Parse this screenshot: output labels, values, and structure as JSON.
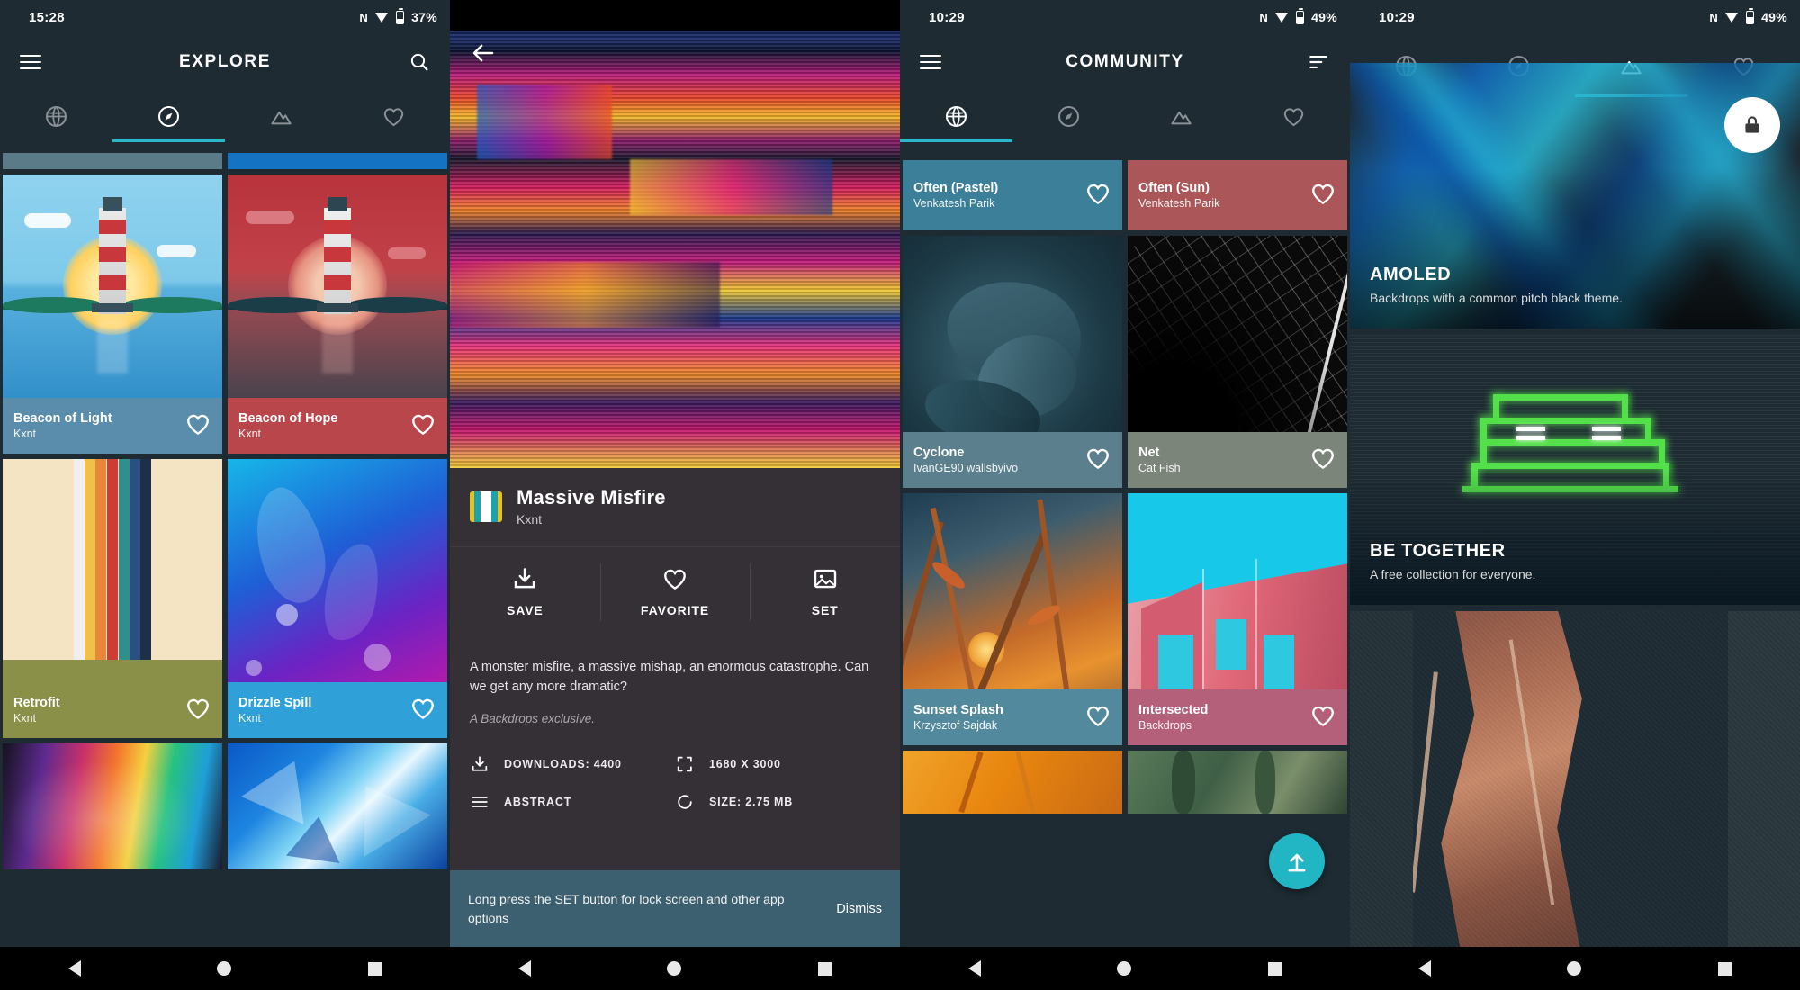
{
  "colors": {
    "app_bg": "#1e2b33",
    "accent": "#29b6c6",
    "detail_bg": "#343036",
    "snack_bg": "#3c6070",
    "fab": "#22b5c4"
  },
  "panel1": {
    "status": {
      "time": "15:28",
      "network_icon": "N",
      "wifi_icon": "wifi-icon",
      "battery_icon": "battery-icon",
      "battery": "37%"
    },
    "appbar": {
      "menu_icon": "hamburger-menu-icon",
      "title": "EXPLORE",
      "action_icon": "search-icon"
    },
    "tabs": [
      {
        "name": "globe-icon",
        "active": false
      },
      {
        "name": "compass-icon",
        "active": true
      },
      {
        "name": "landscape-icon",
        "active": false
      },
      {
        "name": "heart-icon",
        "active": false
      }
    ],
    "cards": [
      {
        "name": "Beacon of Light",
        "author": "Kxnt",
        "label_color": "#5a8dab",
        "art": "lighthouse-day"
      },
      {
        "name": "Beacon of Hope",
        "author": "Kxnt",
        "label_color": "#b8464a",
        "art": "lighthouse-dusk"
      },
      {
        "name": "Retrofit",
        "author": "Kxnt",
        "label_color": "#8a9047",
        "art": "retro-stripes"
      },
      {
        "name": "Drizzle Spill",
        "author": "Kxnt",
        "label_color": "#2fa0d8",
        "art": "drizzle"
      }
    ],
    "nav": {
      "back": "back-nav-icon",
      "home": "home-nav-icon",
      "recents": "recents-nav-icon"
    }
  },
  "panel2": {
    "appbar": {
      "back_icon": "back-arrow-icon"
    },
    "wallpaper": {
      "title": "Massive Misfire",
      "author": "Kxnt",
      "palette": [
        "#e8c21d",
        "#1aa3ae",
        "#ffffff",
        "#1aa3ae",
        "#e8c21d"
      ]
    },
    "actions": [
      {
        "icon": "download-icon",
        "label": "SAVE"
      },
      {
        "icon": "heart-icon",
        "label": "FAVORITE"
      },
      {
        "icon": "image-icon",
        "label": "SET"
      }
    ],
    "description": "A monster misfire, a massive mishap, an enormous catastrophe. Can we get any more dramatic?",
    "exclusive": "A Backdrops exclusive.",
    "meta": [
      {
        "icon": "download-icon",
        "text": "DOWNLOADS: 4400"
      },
      {
        "icon": "resolution-icon",
        "text": "1680 X 3000"
      },
      {
        "icon": "category-icon",
        "text": "ABSTRACT"
      },
      {
        "icon": "size-icon",
        "text": "SIZE: 2.75 MB"
      }
    ],
    "snackbar": {
      "message": "Long press the SET button for lock screen and other app options",
      "action": "Dismiss"
    },
    "nav": {
      "back": "back-nav-icon",
      "home": "home-nav-icon",
      "recents": "recents-nav-icon"
    }
  },
  "panel3": {
    "status": {
      "time": "10:29",
      "network_icon": "N",
      "wifi_icon": "wifi-icon",
      "battery_icon": "battery-icon",
      "battery": "49%"
    },
    "appbar": {
      "menu_icon": "hamburger-menu-icon",
      "title": "COMMUNITY",
      "action_icon": "sort-icon"
    },
    "tabs": [
      {
        "name": "globe-icon",
        "active": true
      },
      {
        "name": "compass-icon",
        "active": false
      },
      {
        "name": "landscape-icon",
        "active": false
      },
      {
        "name": "heart-icon",
        "active": false
      }
    ],
    "cards": [
      {
        "name": "Often (Pastel)",
        "author": "Venkatesh Parik",
        "label_color": "#3b7f99",
        "art": "pastel-glitch"
      },
      {
        "name": "Often (Sun)",
        "author": "Venkatesh Parik",
        "label_color": "#ab5659",
        "art": "sun-glitch"
      },
      {
        "name": "Cyclone",
        "author": "IvanGE90 wallsbyivo",
        "label_color": "#5b7f8c",
        "art": "cyclone"
      },
      {
        "name": "Net",
        "author": "Cat Fish",
        "label_color": "#7b8579",
        "art": "net"
      },
      {
        "name": "Sunset Splash",
        "author": "Krzysztof Sajdak",
        "label_color": "#53899c",
        "art": "sunset-splash"
      },
      {
        "name": "Intersected",
        "author": "Backdrops",
        "label_color": "#b4607b",
        "art": "intersected"
      }
    ],
    "fab_icon": "upload-icon",
    "nav": {
      "back": "back-nav-icon",
      "home": "home-nav-icon",
      "recents": "recents-nav-icon"
    }
  },
  "panel4": {
    "status": {
      "time": "10:29",
      "network_icon": "N",
      "wifi_icon": "wifi-icon",
      "battery_icon": "battery-icon",
      "battery": "49%"
    },
    "tabs": [
      {
        "name": "globe-icon",
        "active": false
      },
      {
        "name": "compass-icon",
        "active": false
      },
      {
        "name": "landscape-icon",
        "active": true
      },
      {
        "name": "heart-icon",
        "active": false
      }
    ],
    "collections": [
      {
        "title": "AMOLED",
        "subtitle": "Backdrops with a common pitch black theme.",
        "art": "amoled",
        "locked": true,
        "lock_icon": "lock-icon"
      },
      {
        "title": "BE TOGETHER",
        "subtitle": "A free collection for everyone.",
        "art": "be-together",
        "locked": false
      },
      {
        "title": "",
        "subtitle": "",
        "art": "aerial",
        "locked": false
      }
    ],
    "nav": {
      "back": "back-nav-icon",
      "home": "home-nav-icon",
      "recents": "recents-nav-icon"
    }
  }
}
